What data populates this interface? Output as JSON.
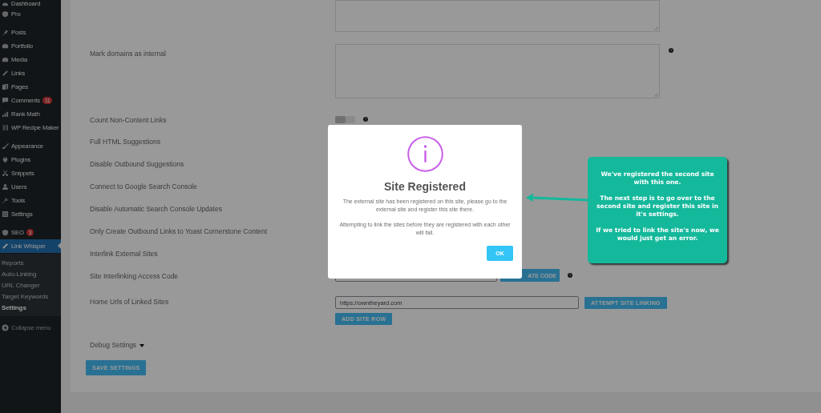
{
  "sidebar": {
    "groups": [
      {
        "items": [
          {
            "label": "Dashboard",
            "selected": false
          },
          {
            "label": "Pro",
            "selected": false
          }
        ]
      },
      {
        "items": [
          {
            "label": "Posts",
            "selected": false
          },
          {
            "label": "Portfolio",
            "selected": false
          },
          {
            "label": "Media",
            "selected": false
          },
          {
            "label": "Links",
            "selected": false
          },
          {
            "label": "Pages",
            "selected": false
          },
          {
            "label": "Comments",
            "badge": "11",
            "selected": false
          },
          {
            "label": "Rank Math",
            "selected": false
          },
          {
            "label": "WP Recipe Maker",
            "selected": false
          }
        ]
      },
      {
        "items": [
          {
            "label": "Appearance",
            "selected": false
          },
          {
            "label": "Plugins",
            "selected": false
          },
          {
            "label": "Snippets",
            "selected": false
          },
          {
            "label": "Users",
            "selected": false
          },
          {
            "label": "Tools",
            "selected": false
          },
          {
            "label": "Settings",
            "selected": false
          }
        ]
      },
      {
        "items": [
          {
            "label": "SEO",
            "badge": "3",
            "selected": false
          },
          {
            "label": "Link Whisper",
            "selected": true,
            "children": [
              {
                "label": "Reports",
                "selected": false
              },
              {
                "label": "Auto-Linking",
                "selected": false
              },
              {
                "label": "URL Changer",
                "selected": false
              },
              {
                "label": "Target Keywords",
                "selected": false
              },
              {
                "label": "Settings",
                "selected": true
              }
            ]
          }
        ]
      }
    ],
    "collapse": "Collapse menu"
  },
  "settings": {
    "rows": [
      {
        "kind": "textarea"
      },
      {
        "kind": "textarea",
        "label": "Mark domains as internal",
        "help": true
      },
      {
        "kind": "toggle",
        "label": "Count Non-Content Links",
        "on": false,
        "help": true
      },
      {
        "kind": "plain",
        "label": "Full HTML Suggestions"
      },
      {
        "kind": "plain",
        "label": "Disable Outbound Suggestions"
      },
      {
        "kind": "plain",
        "label": "Connect to Google Search Console"
      },
      {
        "kind": "plain",
        "label": "Disable Automatic Search Console Updates"
      },
      {
        "kind": "plain",
        "label": "Only Create Outbound Links to Yoast Cornerstone Content"
      },
      {
        "kind": "plain",
        "label": "Interlink External Sites"
      },
      {
        "kind": "code",
        "label": "Site Interlinking Access Code",
        "button": "ATE CODE",
        "help": true
      },
      {
        "kind": "urls",
        "label": "Home Urls of Linked Sites",
        "value": "https://owntheyard.com",
        "button": "ATTEMPT SITE LINKING",
        "add_button": "ADD SITE ROW"
      },
      {
        "kind": "debug",
        "label": "Debug Settings",
        "expanded": false
      }
    ],
    "save_button": "SAVE SETTINGS"
  },
  "modal": {
    "title": "Site Registered",
    "message": [
      "The external site has been registered on this site, please go to the external site and register this site there.",
      "Attempting to link the sites before they are registered with each other will fail."
    ],
    "ok_button": "OK"
  },
  "callout": {
    "paragraphs": [
      "We've registered the second site with this one.",
      "The next step is to go over to the second site and register this site in it's settings.",
      "If we tried to link the site's now, we would just get an error."
    ]
  }
}
